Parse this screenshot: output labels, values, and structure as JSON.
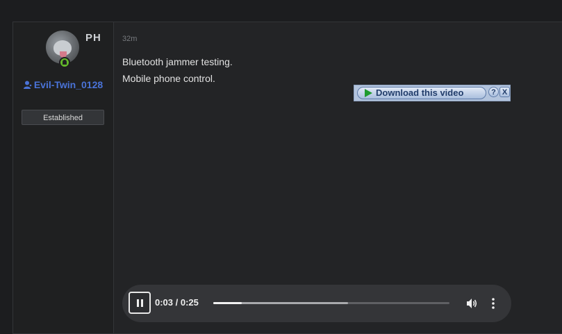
{
  "author": {
    "initials": "PH",
    "username": "Evil-Twin_0128",
    "badge": "Established",
    "online": true
  },
  "post": {
    "time": "32m",
    "lines": [
      "Bluetooth jammer testing.",
      "Mobile phone control."
    ]
  },
  "download_bar": {
    "label": "Download this video",
    "help": "?",
    "close": "X"
  },
  "player": {
    "time": "0:03 / 0:25",
    "current_seconds": 3,
    "duration_seconds": 25,
    "buffered_fraction": 0.57,
    "state": "playing"
  },
  "colors": {
    "accent": "#4a73d8",
    "online": "#63b82b",
    "play_green": "#1f9b2f"
  }
}
